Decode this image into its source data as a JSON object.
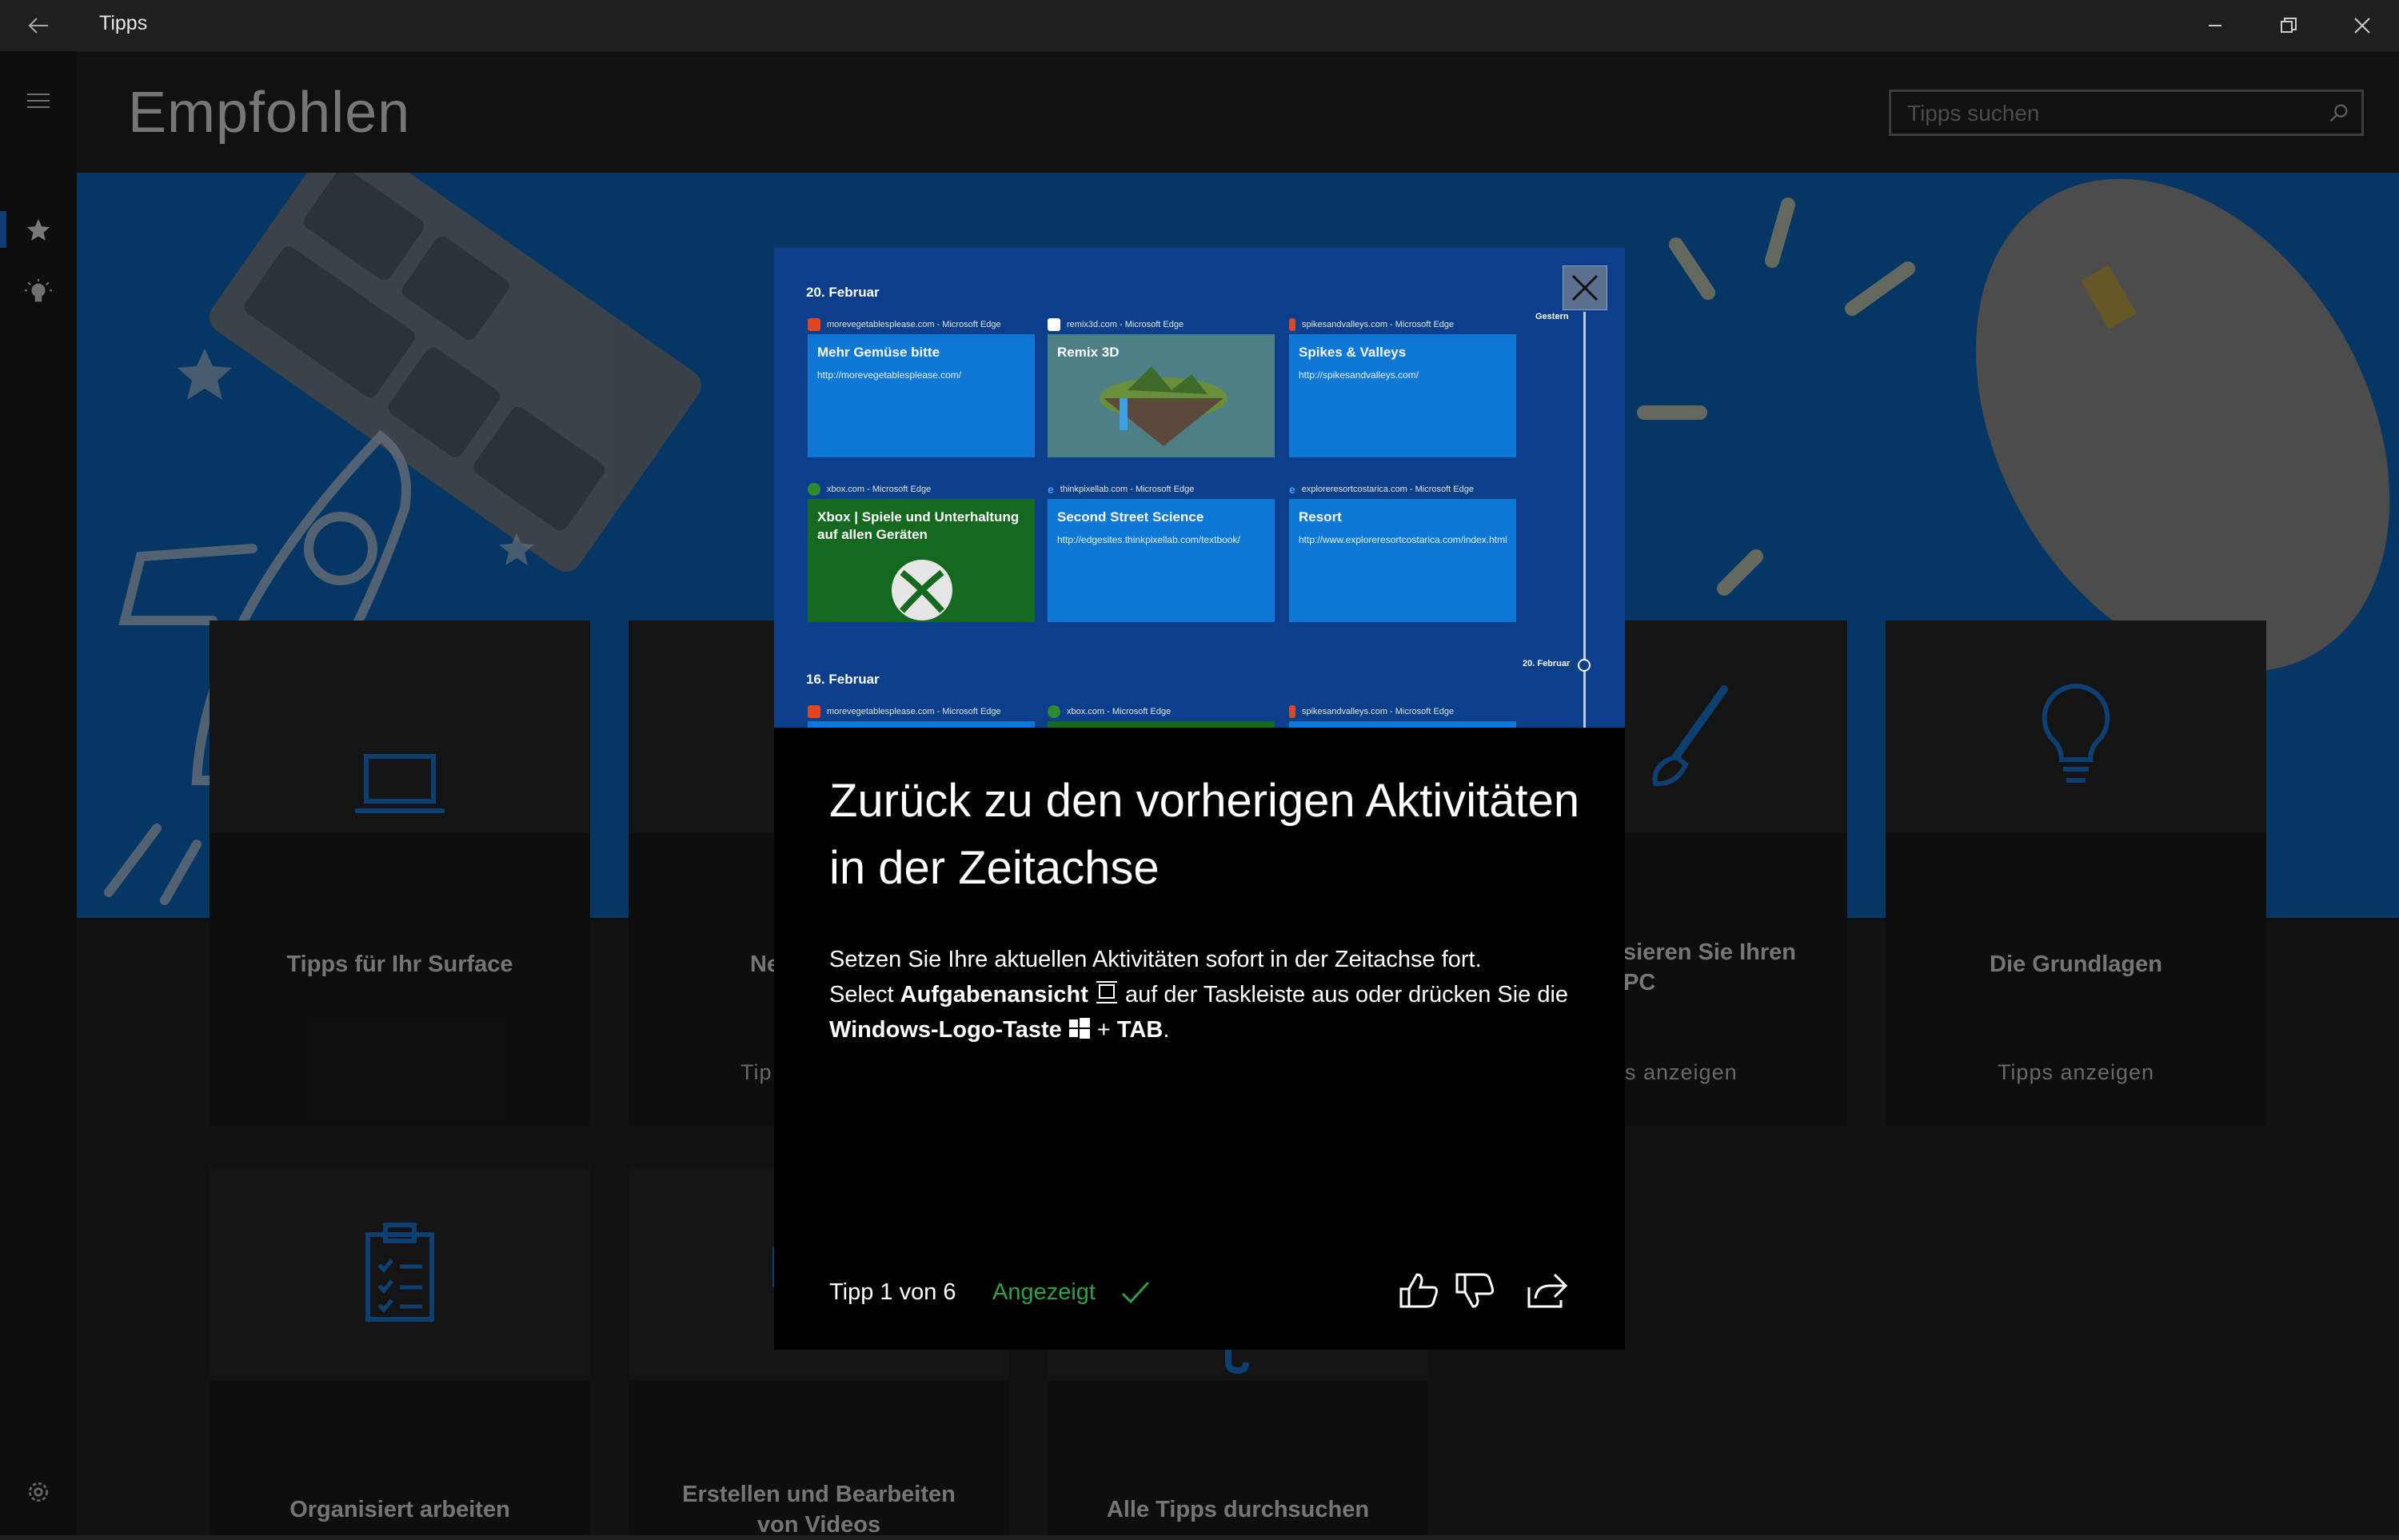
{
  "window": {
    "title": "Tipps"
  },
  "header": {
    "title": "Empfohlen",
    "search_placeholder": "Tipps suchen"
  },
  "cards": [
    {
      "title": "Tipps für Ihr Surface",
      "icon": "laptop-icon"
    },
    {
      "title": "Ne",
      "link": "Tip",
      "icon": "partial-icon"
    },
    {
      "title": "sieren Sie Ihren PC",
      "link": "s anzeigen",
      "icon": "brush-icon"
    },
    {
      "title": "Die Grundlagen",
      "link": "Tipps anzeigen",
      "icon": "lightbulb-icon"
    },
    {
      "title": "Organisiert arbeiten",
      "icon": "clipboard-icon"
    },
    {
      "title": "Erstellen und Bearbeiten von Videos",
      "icon": "video-icon"
    },
    {
      "title": "Alle Tipps durchsuchen",
      "icon": "search-icon"
    }
  ],
  "dialog": {
    "screenshot": {
      "date1": "20. Februar",
      "date2": "16. Februar",
      "timeline_top": "Gestern",
      "timeline_mark": "20. Februar",
      "tiles": [
        {
          "source": "morevegetablesplease.com - Microsoft Edge",
          "title": "Mehr Gemüse bitte",
          "url": "http://morevegetablesplease.com/"
        },
        {
          "source": "remix3d.com - Microsoft Edge",
          "title": "Remix 3D",
          "url": ""
        },
        {
          "source": "spikesandvalleys.com - Microsoft Edge",
          "title": "Spikes & Valleys",
          "url": "http://spikesandvalleys.com/"
        },
        {
          "source": "xbox.com - Microsoft Edge",
          "title": "Xbox | Spiele und Unterhaltung auf allen Geräten",
          "url": ""
        },
        {
          "source": "thinkpixellab.com - Microsoft Edge",
          "title": "Second Street Science",
          "url": "http://edgesites.thinkpixellab.com/textbook/"
        },
        {
          "source": "exploreresortcostarica.com - Microsoft Edge",
          "title": "Resort",
          "url": "http://www.exploreresortcostarica.com/index.html"
        }
      ],
      "row2_sources": [
        "morevegetablesplease.com - Microsoft Edge",
        "xbox.com - Microsoft Edge",
        "spikesandvalleys.com - Microsoft Edge"
      ]
    },
    "title": "Zurück zu den vorherigen Aktivitäten in der Zeitachse",
    "body": {
      "line1": "Setzen Sie Ihre aktuellen Aktivitäten sofort in der Zeitachse fort.",
      "select": "Select ",
      "task_view": "Aufgabenansicht",
      "after_task_view": " auf der Taskleiste aus oder drücken Sie die ",
      "win_key": "Windows-Logo-Taste",
      "plus": " + ",
      "tab": "TAB",
      "period": "."
    },
    "footer": {
      "count": "Tipp 1 von 6",
      "seen": "Angezeigt"
    }
  },
  "colors": {
    "accent": "#1a73d2",
    "hero_blue": "#0b63b5",
    "tile_blue": "#0f78d7",
    "seen_green": "#2ea043"
  }
}
